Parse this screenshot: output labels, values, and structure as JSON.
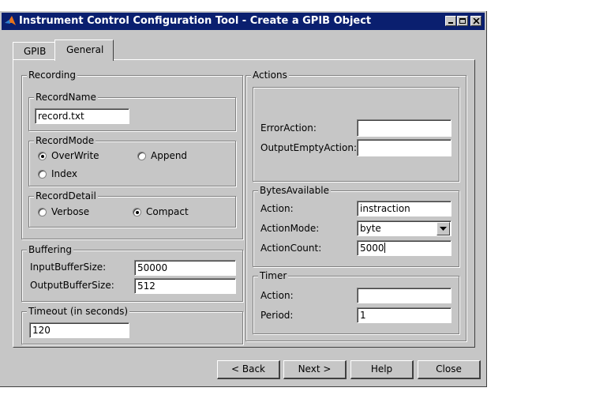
{
  "window": {
    "title": "Instrument Control Configuration Tool - Create a GPIB Object"
  },
  "tabs": [
    {
      "label": "GPIB"
    },
    {
      "label": "General"
    }
  ],
  "recording": {
    "title": "Recording",
    "record_name": {
      "title": "RecordName",
      "value": "record.txt"
    },
    "record_mode": {
      "title": "RecordMode",
      "options": [
        "OverWrite",
        "Append",
        "Index"
      ],
      "selected": "OverWrite"
    },
    "record_detail": {
      "title": "RecordDetail",
      "options": [
        "Verbose",
        "Compact"
      ],
      "selected": "Compact"
    }
  },
  "buffering": {
    "title": "Buffering",
    "input_label": "InputBufferSize:",
    "input_value": "50000",
    "output_label": "OutputBufferSize:",
    "output_value": "512"
  },
  "timeout": {
    "title": "Timeout (in seconds)",
    "value": "120"
  },
  "actions": {
    "title": "Actions",
    "error_label": "ErrorAction:",
    "error_value": "",
    "output_empty_label": "OutputEmptyAction:",
    "output_empty_value": ""
  },
  "bytes_available": {
    "title": "BytesAvailable",
    "action_label": "Action:",
    "action_value": "instraction",
    "mode_label": "ActionMode:",
    "mode_value": "byte",
    "count_label": "ActionCount:",
    "count_value": "5000"
  },
  "timer": {
    "title": "Timer",
    "action_label": "Action:",
    "action_value": "",
    "period_label": "Period:",
    "period_value": "1"
  },
  "buttons": {
    "back": "< Back",
    "next": "Next >",
    "help": "Help",
    "close": "Close"
  }
}
